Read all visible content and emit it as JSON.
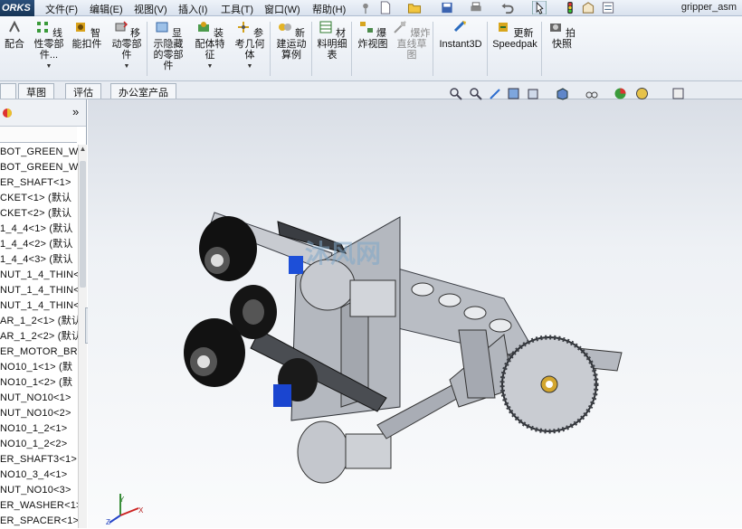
{
  "app": {
    "logo": "ORKS",
    "document_title": "gripper_asm"
  },
  "menu": [
    {
      "id": "file",
      "label": "文件(F)"
    },
    {
      "id": "edit",
      "label": "编辑(E)"
    },
    {
      "id": "view",
      "label": "视图(V)"
    },
    {
      "id": "insert",
      "label": "插入(I)"
    },
    {
      "id": "tools",
      "label": "工具(T)"
    },
    {
      "id": "window",
      "label": "窗口(W)"
    },
    {
      "id": "help",
      "label": "帮助(H)"
    }
  ],
  "ribbon": {
    "mate": "配合",
    "linear_pattern": "线性零部件...",
    "smart_fasteners": "智能扣件",
    "move_component": "移动零部件",
    "show_hidden": "显示隐藏的零部件",
    "assembly_features": "装配体特征",
    "reference_geometry": "参考几何体",
    "new_motion_study": "新建运动算例",
    "bom": "材料明细表",
    "exploded_view": "爆炸视图",
    "explode_line_sketch": "爆炸直线草图",
    "instant3d": "Instant3D",
    "update_speedpak": "更新Speedpak",
    "snapshot": "拍快照"
  },
  "tabs": [
    "草图",
    "评估",
    "办公室产品"
  ],
  "panel": {
    "collapse": "»"
  },
  "tree": [
    "BOT_GREEN_W",
    "BOT_GREEN_W",
    "ER_SHAFT<1>",
    "CKET<1> (默认",
    "CKET<2> (默认",
    "1_4_4<1> (默认",
    "1_4_4<2> (默认",
    "1_4_4<3> (默认",
    "NUT_1_4_THIN<",
    "NUT_1_4_THIN<",
    "NUT_1_4_THIN<",
    "AR_1_2<1> (默认",
    "AR_1_2<2> (默认",
    "ER_MOTOR_BR",
    "NO10_1<1> (默",
    "NO10_1<2> (默",
    "NUT_NO10<1>",
    "NUT_NO10<2>",
    "NO10_1_2<1>",
    "NO10_1_2<2>",
    "ER_SHAFT3<1>",
    "NO10_3_4<1>",
    "NUT_NO10<3>",
    "ER_WASHER<1>",
    "ER_SPACER<1>"
  ],
  "watermark": "沐风网",
  "triad": {
    "x": "X",
    "y": "Y",
    "z": "Z"
  }
}
